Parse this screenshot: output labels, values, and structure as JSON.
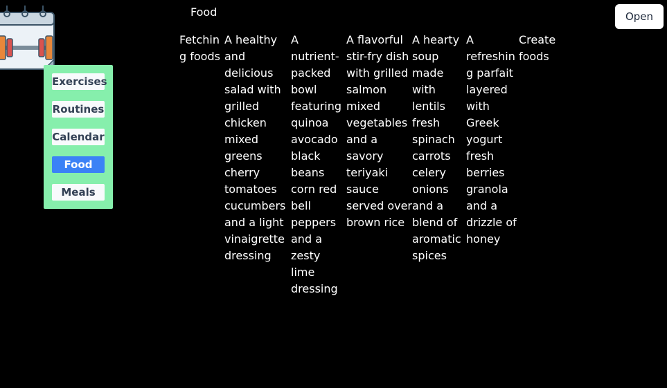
{
  "header": {
    "title": "Food",
    "open_button": "Open"
  },
  "sidebar": {
    "items": [
      {
        "label": "Exercises",
        "active": false
      },
      {
        "label": "Routines",
        "active": false
      },
      {
        "label": "Calendar",
        "active": false
      },
      {
        "label": "Food",
        "active": true
      },
      {
        "label": "Meals",
        "active": false
      }
    ]
  },
  "content": {
    "status": "Fetching foods",
    "foods": [
      {
        "description": "A healthy and delicious salad with grilled chicken mixed greens cherry tomatoes cucumbers and a light vinaigrette dressing"
      },
      {
        "description": "A nutrient-packed bowl featuring quinoa avocado black beans corn red bell peppers and a zesty lime dressing"
      },
      {
        "description": "A flavorful stir-fry dish with grilled salmon mixed vegetables and a savory teriyaki sauce served over brown rice"
      },
      {
        "description": "A hearty soup made with lentils fresh spinach carrots celery onions and a blend of aromatic spices"
      },
      {
        "description": "A refreshing parfait layered with Greek yogurt fresh berries granola and a drizzle of honey"
      }
    ],
    "create_label": "Create foods"
  },
  "colors": {
    "background": "#000000",
    "sidebar": "#86efac",
    "active": "#3b82f6"
  }
}
